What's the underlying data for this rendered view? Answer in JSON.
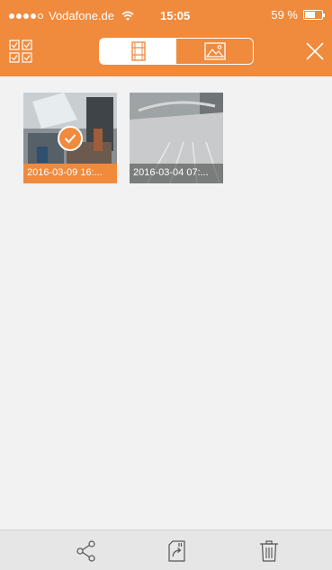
{
  "status_bar": {
    "carrier": "Vodafone.de",
    "time": "15:05",
    "battery_percent_label": "59 %",
    "battery_level": 0.59,
    "signal_bars_filled": 4,
    "signal_bars_total": 5
  },
  "toolbar": {
    "segments": [
      {
        "name": "video-segment",
        "icon": "film-icon",
        "active": true
      },
      {
        "name": "photo-segment",
        "icon": "image-icon",
        "active": false
      }
    ],
    "left_icon": "select-all-icon",
    "right_icon": "close-icon"
  },
  "items": [
    {
      "caption": "2016-03-09 16:...",
      "selected": true
    },
    {
      "caption": "2016-03-04 07:...",
      "selected": false
    }
  ],
  "bottom_bar": {
    "icons": [
      "share-icon",
      "export-icon",
      "trash-icon"
    ]
  },
  "colors": {
    "accent": "#f08a3c",
    "content_background": "#f2f2f2",
    "bottom_bar": "#e6e6e6"
  }
}
